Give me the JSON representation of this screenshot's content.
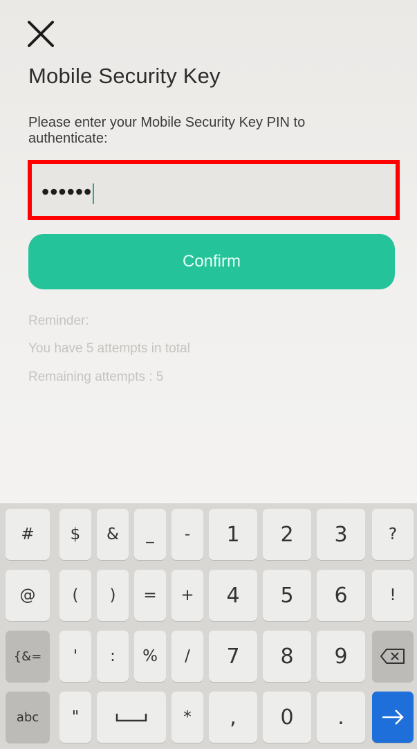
{
  "header": {
    "close_icon": "close-icon",
    "title": "Mobile Security Key"
  },
  "form": {
    "instruction": "Please enter your Mobile Security Key PIN to authenticate:",
    "pin_value": "••••••",
    "confirm_label": "Confirm"
  },
  "reminder": {
    "heading": "Reminder:",
    "attempts_total": "You have 5 attempts in total",
    "attempts_remaining": "Remaining attempts : 5"
  },
  "keyboard": {
    "row1": [
      "#",
      "$",
      "&",
      "_",
      "-",
      "1",
      "2",
      "3",
      "?"
    ],
    "row2": [
      "@",
      "(",
      ")",
      "=",
      "+",
      "4",
      "5",
      "6",
      "!"
    ],
    "row3": [
      "{&=",
      "'",
      ":",
      "%",
      "/",
      "7",
      "8",
      "9"
    ],
    "row4": [
      "abc",
      "\"",
      "*",
      ",",
      "0",
      "."
    ],
    "backspace_icon": "backspace-icon",
    "space_icon": "space-bar-icon",
    "enter_icon": "arrow-right-icon"
  },
  "colors": {
    "accent": "#24c39a",
    "highlight_border": "#ff0000",
    "enter_key": "#1e6fd9"
  }
}
